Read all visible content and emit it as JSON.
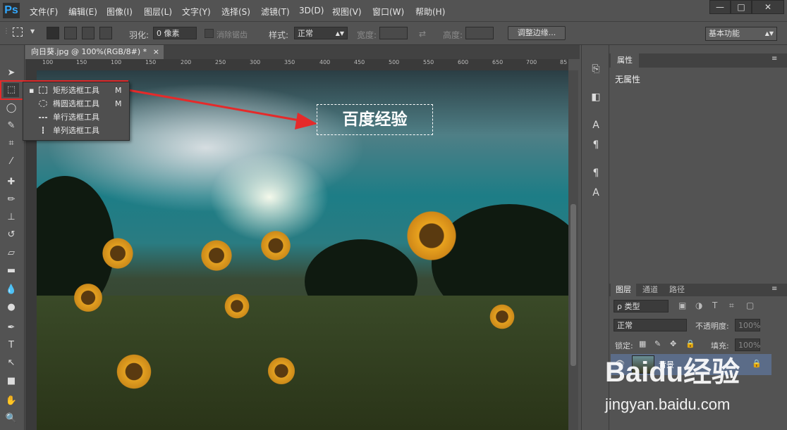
{
  "app": {
    "logo": "Ps",
    "window_buttons": [
      "—",
      "□",
      "✕"
    ]
  },
  "menu": [
    "文件(F)",
    "编辑(E)",
    "图像(I)",
    "图层(L)",
    "文字(Y)",
    "选择(S)",
    "滤镜(T)",
    "3D(D)",
    "视图(V)",
    "窗口(W)",
    "帮助(H)"
  ],
  "options": {
    "feather_label": "羽化:",
    "feather_value": "0 像素",
    "antialias_label": "消除锯齿",
    "style_label": "样式:",
    "style_value": "正常",
    "width_label": "宽度:",
    "height_label": "高度:",
    "refine_button": "调整边缘...",
    "workspace": "基本功能"
  },
  "document": {
    "tab_title": "向日葵.jpg @ 100%(RGB/8#) *",
    "ruler_ticks": [
      "100",
      "150",
      "100",
      "150",
      "200",
      "250",
      "300",
      "350",
      "400",
      "450",
      "500",
      "550",
      "600",
      "650",
      "700",
      "750",
      "800",
      "85"
    ]
  },
  "flyout": {
    "items": [
      {
        "label": "矩形选框工具",
        "key": "M"
      },
      {
        "label": "椭圆选框工具",
        "key": "M"
      },
      {
        "label": "单行选框工具",
        "key": ""
      },
      {
        "label": "单列选框工具",
        "key": ""
      }
    ]
  },
  "annotation": {
    "marquee_text": "百度经验",
    "highlight_color": "#e52a2a"
  },
  "properties": {
    "tab": "属性",
    "content": "无属性"
  },
  "layers": {
    "tabs": [
      "图层",
      "通道",
      "路径"
    ],
    "filter_label": "ρ 类型",
    "blend_mode": "正常",
    "opacity_label": "不透明度:",
    "opacity_value": "100%",
    "lock_label": "锁定:",
    "fill_label": "填充:",
    "fill_value": "100%",
    "layer_name": "背景"
  },
  "watermark": {
    "brand": "Baidu经验",
    "url": "jingyan.baidu.com"
  }
}
